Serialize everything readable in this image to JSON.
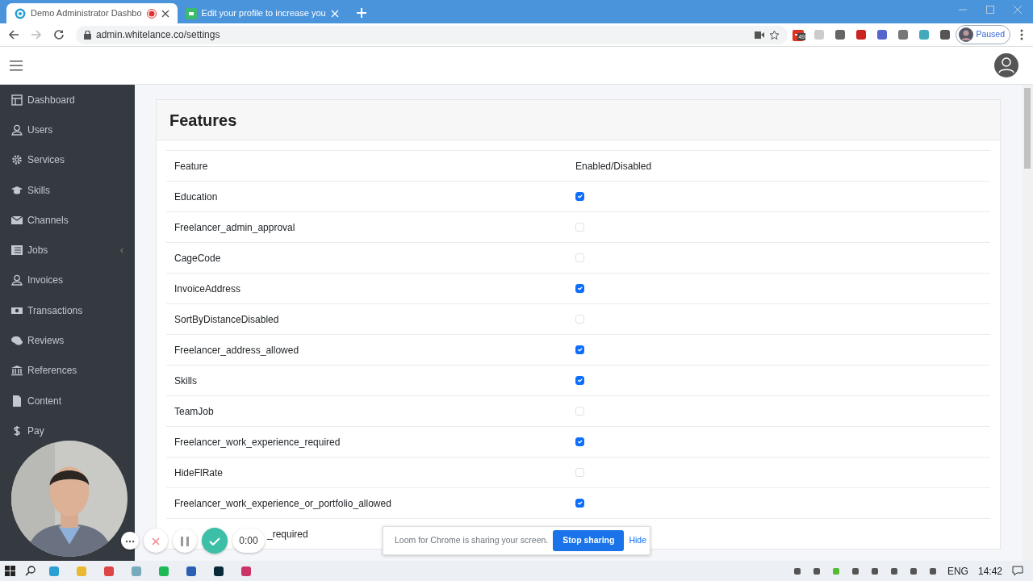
{
  "browser": {
    "tabs": [
      {
        "title": "Demo Administrator Dashbo",
        "selected": true,
        "recording": true
      },
      {
        "title": "Edit your profile to increase you",
        "selected": false,
        "recording": false
      }
    ],
    "address": "admin.whitelance.co/settings",
    "extension_badge": "49",
    "profile_label": "Paused"
  },
  "sidebar": {
    "items": [
      {
        "label": "Dashboard"
      },
      {
        "label": "Users"
      },
      {
        "label": "Services"
      },
      {
        "label": "Skills"
      },
      {
        "label": "Channels"
      },
      {
        "label": "Jobs",
        "caret": "‹"
      },
      {
        "label": "Invoices"
      },
      {
        "label": "Transactions"
      },
      {
        "label": "Reviews"
      },
      {
        "label": "References"
      },
      {
        "label": "Content"
      },
      {
        "label": "Pay"
      }
    ]
  },
  "card": {
    "title": "Features",
    "columns": [
      "Feature",
      "Enabled/Disabled"
    ],
    "rows": [
      {
        "feature": "Education",
        "enabled": true
      },
      {
        "feature": "Freelancer_admin_approval",
        "enabled": false
      },
      {
        "feature": "CageCode",
        "enabled": false
      },
      {
        "feature": "InvoiceAddress",
        "enabled": true
      },
      {
        "feature": "SortByDistanceDisabled",
        "enabled": false
      },
      {
        "feature": "Freelancer_address_allowed",
        "enabled": true
      },
      {
        "feature": "Skills",
        "enabled": true
      },
      {
        "feature": "TeamJob",
        "enabled": false
      },
      {
        "feature": "Freelancer_work_experience_required",
        "enabled": true
      },
      {
        "feature": "HideFlRate",
        "enabled": false
      },
      {
        "feature": "Freelancer_work_experience_or_portfolio_allowed",
        "enabled": true
      },
      {
        "feature": "_required"
      }
    ]
  },
  "loom": {
    "timer": "0:00",
    "message": "Loom for Chrome is sharing your screen.",
    "stop_button": "Stop sharing",
    "hide_link": "Hide"
  },
  "taskbar": {
    "language": "ENG",
    "time": "14:42"
  }
}
